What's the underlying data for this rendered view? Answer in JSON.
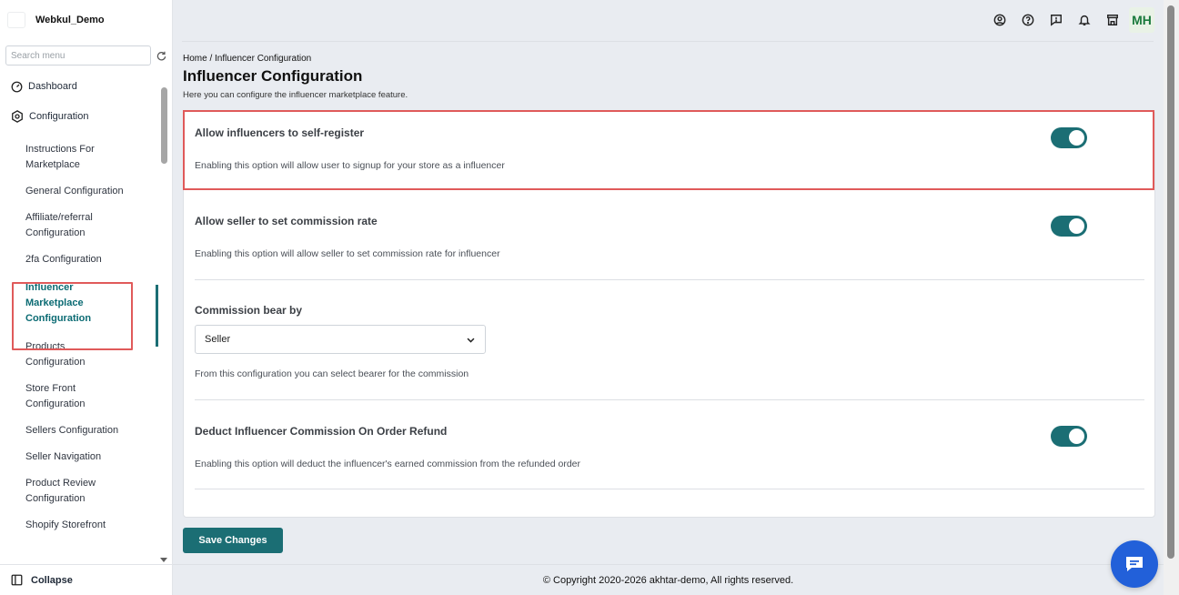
{
  "sidebar": {
    "brand": "Webkul_Demo",
    "search_placeholder": "Search menu",
    "dashboard": "Dashboard",
    "configuration": "Configuration",
    "items": [
      "Instructions For Marketplace",
      "General Configuration",
      "Affiliate/referral Configuration",
      "2fa Configuration",
      "Influencer Marketplace Configuration",
      "Products Configuration",
      "Store Front Configuration",
      "Sellers Configuration",
      "Seller Navigation",
      "Product Review Configuration",
      "Shopify Storefront"
    ],
    "collapse": "Collapse"
  },
  "header": {
    "avatar_initials": "MH",
    "icons": [
      "user-circle-icon",
      "help-icon",
      "feedback-icon",
      "bell-icon",
      "store-icon"
    ]
  },
  "main": {
    "breadcrumb": "Home / Influencer Configuration",
    "title": "Influencer Configuration",
    "subtitle": "Here you can configure the influencer marketplace feature.",
    "settings": [
      {
        "title": "Allow influencers to self-register",
        "desc": "Enabling this option will allow user to signup for your store as a influencer",
        "enabled": true
      },
      {
        "title": "Allow seller to set commission rate",
        "desc": "Enabling this option will allow seller to set commission rate for influencer",
        "enabled": true
      },
      {
        "title": "Commission bear by",
        "selected": "Seller",
        "desc": "From this configuration you can select bearer for the commission"
      },
      {
        "title": "Deduct Influencer Commission On Order Refund",
        "desc": "Enabling this option will deduct the influencer's earned commission from the refunded order",
        "enabled": true
      }
    ],
    "save_label": "Save Changes"
  },
  "footer": {
    "copyright": "© Copyright 2020-2026 akhtar-demo, All rights reserved."
  },
  "colors": {
    "accent": "#1b6e74",
    "highlight": "#e05a5a",
    "chat": "#2260d9"
  }
}
